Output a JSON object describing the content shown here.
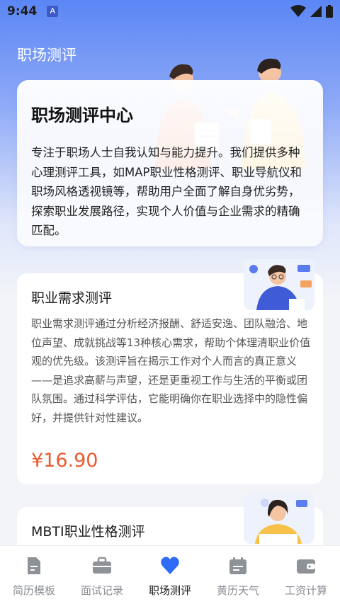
{
  "status_bar": {
    "time": "9:44",
    "app_icon_letter": "A"
  },
  "header": {
    "title": "职场测评"
  },
  "hero": {
    "title": "职场测评中心",
    "description": "专注于职场人士自我认知与能力提升。我们提供多种心理测评工具，如MAP职业性格测评、职业导航仪和职场风格透视镜等，帮助用户全面了解自身优劣势，探索职业发展路径，实现个人价值与企业需求的精确匹配。"
  },
  "tests": [
    {
      "title": "职业需求测评",
      "description": "职业需求测评通过分析经济报酬、舒适安逸、团队融洽、地位声望、成就挑战等13种核心需求，帮助个体理清职业价值观的优先级。该测评旨在揭示工作对个人而言的真正意义——是追求高薪与声望，还是更重视工作与生活的平衡或团队氛围。通过科学评估，它能明确你在职业选择中的隐性偏好，并提供针对性建议。",
      "price": "¥16.90"
    },
    {
      "title": "MBTI职业性格测评"
    }
  ],
  "tab_bar": {
    "items": [
      {
        "label": "简历模板",
        "icon": "document-icon",
        "active": false
      },
      {
        "label": "面试记录",
        "icon": "briefcase-icon",
        "active": false
      },
      {
        "label": "职场测评",
        "icon": "heart-icon",
        "active": true
      },
      {
        "label": "黄历天气",
        "icon": "calendar-icon",
        "active": false
      },
      {
        "label": "工资计算",
        "icon": "wallet-icon",
        "active": false
      }
    ]
  },
  "colors": {
    "accent": "#2f6cf6",
    "price": "#ea5a2e",
    "header_gradient_top": "#5b86f5"
  }
}
